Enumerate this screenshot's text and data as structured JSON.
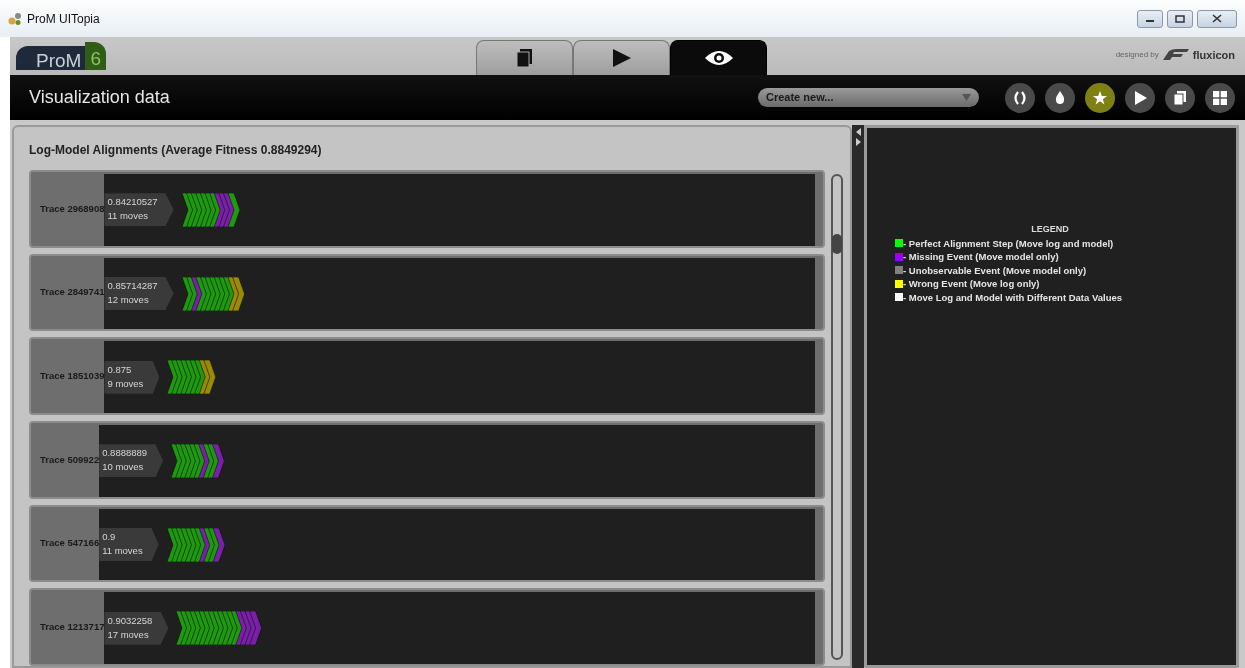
{
  "window": {
    "title": "ProM UITopia"
  },
  "header": {
    "logo": {
      "name": "ProM",
      "version": "6"
    },
    "tabs": [
      {
        "selected": false
      },
      {
        "selected": false
      },
      {
        "selected": true
      }
    ],
    "credit": {
      "prefix": "designed by",
      "brand": "fluxicon"
    }
  },
  "toolbar": {
    "title": "Visualization data",
    "dropdown": {
      "value": "Create new..."
    },
    "buttons": [
      {
        "selected": false
      },
      {
        "selected": false
      },
      {
        "selected": true
      },
      {
        "selected": false
      },
      {
        "selected": false
      },
      {
        "selected": false
      }
    ]
  },
  "alignments": {
    "title": "Log-Model Alignments (Average Fitness 0.8849294)",
    "traces": [
      {
        "name": "Trace 2968908",
        "fitness": "0.84210527",
        "moves_label": "11 moves",
        "moves": [
          {
            "color": "#1f9a10"
          },
          {
            "color": "#1f9a10"
          },
          {
            "color": "#1f9a10"
          },
          {
            "color": "#1f9a10"
          },
          {
            "color": "#1f9a10"
          },
          {
            "color": "#1f9a10"
          },
          {
            "color": "#1f9a10"
          },
          {
            "color": "#7a20a8"
          },
          {
            "color": "#7a20a8"
          },
          {
            "color": "#7a20a8"
          },
          {
            "color": "#1f9a10"
          }
        ]
      },
      {
        "name": "Trace 2849741",
        "fitness": "0.85714287",
        "moves_label": "12 moves",
        "moves": [
          {
            "color": "#1f9a10"
          },
          {
            "color": "#1f9a10"
          },
          {
            "color": "#7a20a8"
          },
          {
            "color": "#1f9a10"
          },
          {
            "color": "#1f9a10"
          },
          {
            "color": "#1f9a10"
          },
          {
            "color": "#1f9a10"
          },
          {
            "color": "#1f9a10"
          },
          {
            "color": "#1f9a10"
          },
          {
            "color": "#1f9a10"
          },
          {
            "color": "#9a8a05"
          },
          {
            "color": "#9a8a05"
          }
        ]
      },
      {
        "name": "Trace 1851039",
        "fitness": "0.875",
        "moves_label": "9 moves",
        "moves": [
          {
            "color": "#1f9a10"
          },
          {
            "color": "#1f9a10"
          },
          {
            "color": "#1f9a10"
          },
          {
            "color": "#1f9a10"
          },
          {
            "color": "#1f9a10"
          },
          {
            "color": "#1f9a10"
          },
          {
            "color": "#1f9a10"
          },
          {
            "color": "#9a8a05"
          },
          {
            "color": "#9a8a05"
          }
        ]
      },
      {
        "name": "Trace 509922",
        "fitness": "0.8888889",
        "moves_label": "10 moves",
        "moves": [
          {
            "color": "#1f9a10"
          },
          {
            "color": "#1f9a10"
          },
          {
            "color": "#1f9a10"
          },
          {
            "color": "#1f9a10"
          },
          {
            "color": "#1f9a10"
          },
          {
            "color": "#1f9a10"
          },
          {
            "color": "#7a20a8"
          },
          {
            "color": "#1f9a10"
          },
          {
            "color": "#1f9a10"
          },
          {
            "color": "#7a20a8"
          }
        ]
      },
      {
        "name": "Trace 547166",
        "fitness": "0.9",
        "moves_label": "11 moves",
        "moves": [
          {
            "color": "#1f9a10"
          },
          {
            "color": "#1f9a10"
          },
          {
            "color": "#1f9a10"
          },
          {
            "color": "#1f9a10"
          },
          {
            "color": "#1f9a10"
          },
          {
            "color": "#1f9a10"
          },
          {
            "color": "#1f9a10"
          },
          {
            "color": "#7a20a8"
          },
          {
            "color": "#1f9a10"
          },
          {
            "color": "#1f9a10"
          },
          {
            "color": "#7a20a8"
          }
        ]
      },
      {
        "name": "Trace 1213717",
        "fitness": "0.9032258",
        "moves_label": "17 moves",
        "moves": [
          {
            "color": "#1f9a10"
          },
          {
            "color": "#1f9a10"
          },
          {
            "color": "#1f9a10"
          },
          {
            "color": "#1f9a10"
          },
          {
            "color": "#1f9a10"
          },
          {
            "color": "#1f9a10"
          },
          {
            "color": "#1f9a10"
          },
          {
            "color": "#1f9a10"
          },
          {
            "color": "#1f9a10"
          },
          {
            "color": "#1f9a10"
          },
          {
            "color": "#1f9a10"
          },
          {
            "color": "#1f9a10"
          },
          {
            "color": "#1f9a10"
          },
          {
            "color": "#7a20a8"
          },
          {
            "color": "#7a20a8"
          },
          {
            "color": "#7a20a8"
          },
          {
            "color": "#7a20a8"
          }
        ]
      }
    ]
  },
  "legend": {
    "title": "LEGEND",
    "items": [
      {
        "label": "- Perfect Alignment Step (Move log and model)",
        "color": "#00ff00"
      },
      {
        "label": "- Missing Event (Move model only)",
        "color": "#9900ff"
      },
      {
        "label": "- Unobservable Event (Move model only)",
        "color": "#808080"
      },
      {
        "label": "- Wrong Event (Move log only)",
        "color": "#ffff00"
      },
      {
        "label": "- Move Log and Model with Different Data Values",
        "color": "#ffffff"
      }
    ]
  }
}
